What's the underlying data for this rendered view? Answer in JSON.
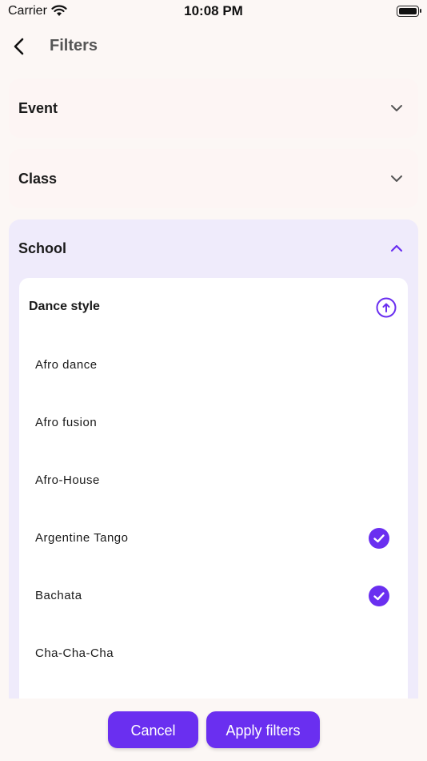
{
  "status_bar": {
    "carrier": "Carrier",
    "time": "10:08 PM"
  },
  "nav": {
    "title": "Filters"
  },
  "sections": {
    "event": {
      "title": "Event",
      "expanded": false
    },
    "class": {
      "title": "Class",
      "expanded": false
    },
    "school": {
      "title": "School",
      "expanded": true,
      "dance_style": {
        "title": "Dance style",
        "options": [
          {
            "label": "Afro dance",
            "checked": false
          },
          {
            "label": "Afro fusion",
            "checked": false
          },
          {
            "label": "Afro-House",
            "checked": false
          },
          {
            "label": "Argentine Tango",
            "checked": true
          },
          {
            "label": "Bachata",
            "checked": true
          },
          {
            "label": "Cha-Cha-Cha",
            "checked": false
          }
        ]
      }
    }
  },
  "actions": {
    "cancel": "Cancel",
    "apply": "Apply filters"
  },
  "colors": {
    "accent": "#6a2ff0",
    "background": "#fcf7f5",
    "expanded_card": "#efebfb"
  }
}
